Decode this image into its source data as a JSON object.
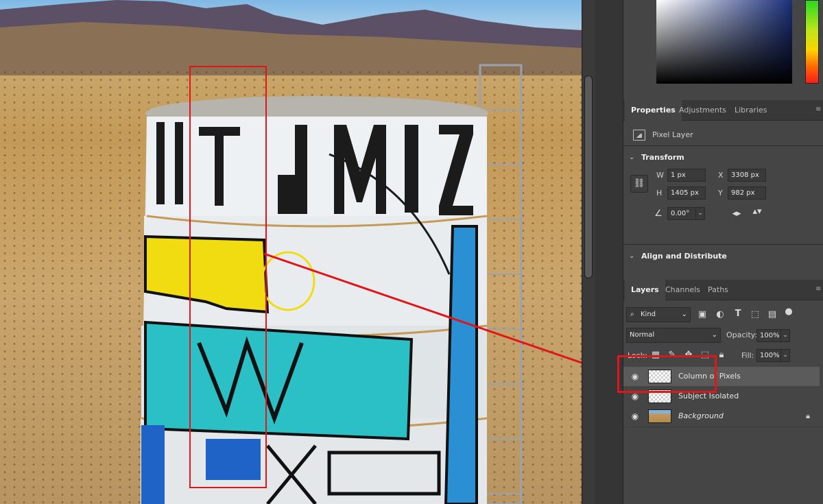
{
  "properties_tabs": [
    "Properties",
    "Adjustments",
    "Libraries"
  ],
  "properties": {
    "layer_type": "Pixel Layer",
    "transform_title": "Transform",
    "w_label": "W",
    "w_value": "1 px",
    "h_label": "H",
    "h_value": "1405 px",
    "x_label": "X",
    "x_value": "3308 px",
    "y_label": "Y",
    "y_value": "982 px",
    "angle_value": "0.00°",
    "align_title": "Align and Distribute"
  },
  "layers_tabs": [
    "Layers",
    "Channels",
    "Paths"
  ],
  "layers": {
    "filter_kind": "Kind",
    "blend_mode": "Normal",
    "opacity_label": "Opacity:",
    "opacity_value": "100%",
    "lock_label": "Lock:",
    "fill_label": "Fill:",
    "fill_value": "100%",
    "items": [
      {
        "name": "Column of Pixels",
        "selected": true,
        "thumb": "transparent",
        "italic": false,
        "locked": false
      },
      {
        "name": "Subject Isolated",
        "selected": false,
        "thumb": "transparent",
        "italic": false,
        "locked": false
      },
      {
        "name": "Background",
        "selected": false,
        "thumb": "photo",
        "italic": true,
        "locked": true
      }
    ]
  },
  "colors": {
    "selection_red": "#e0161b",
    "panel_bg": "#454545",
    "selected_layer_bg": "#5b5b5b"
  },
  "icons": [
    "pixel-layer-icon",
    "link-icon",
    "angle-icon",
    "flip-horizontal-icon",
    "flip-vertical-icon",
    "search-icon",
    "eye-icon",
    "lock-icon"
  ]
}
